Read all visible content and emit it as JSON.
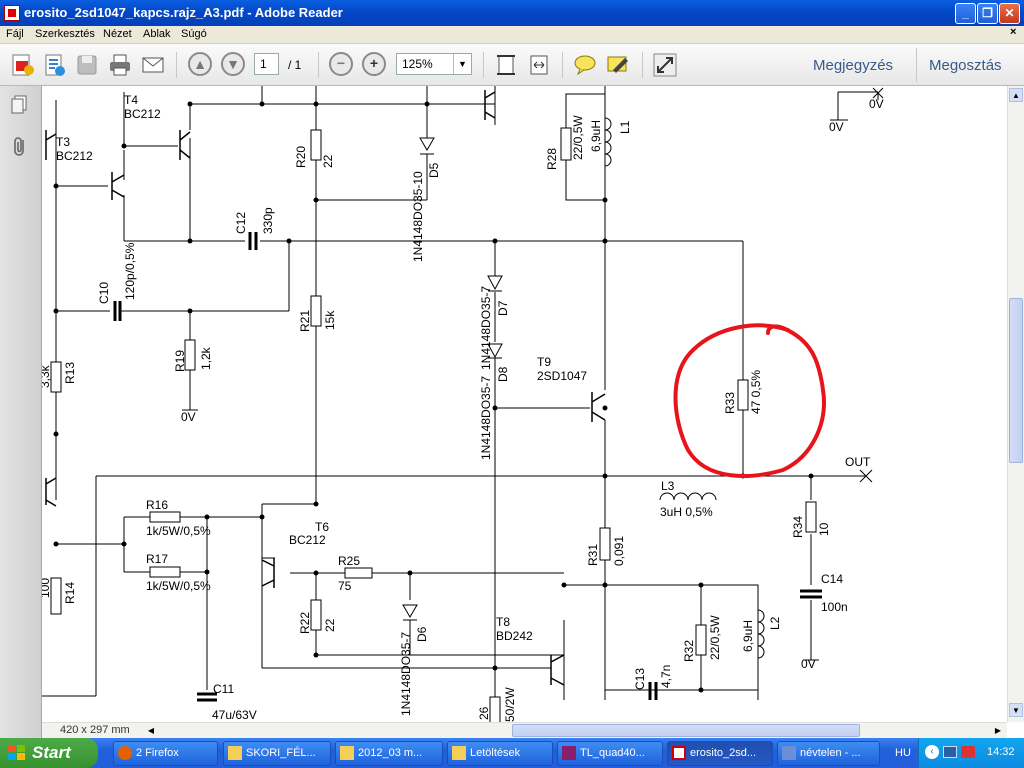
{
  "window": {
    "title": "erosito_2sd1047_kapcs.rajz_A3.pdf - Adobe Reader",
    "buttons": {
      "minimize": "_",
      "maximize": "❐",
      "close": "✕"
    }
  },
  "menu": [
    "Fájl",
    "Szerkesztés",
    "Nézet",
    "Ablak",
    "Súgó"
  ],
  "toolbar": {
    "page_value": "1",
    "page_total": "/ 1",
    "zoom_value": "125%",
    "comment_link": "Megjegyzés",
    "share_link": "Megosztás"
  },
  "statusbar": {
    "page_size": "420 x 297 mm"
  },
  "schematic": {
    "components": {
      "T4": "T4",
      "BC212_a": "BC212",
      "T3": "T3",
      "BC212_b": "BC212",
      "R20": "R20",
      "R20_val": "22",
      "D5": "D5",
      "D5_type": "1N4148DO35-10",
      "R28": "R28",
      "R28_val": "22/0,5W",
      "L1": "L1",
      "L1_val": "6,9uH",
      "C12": "C12",
      "C12_val": "330p",
      "C10": "C10",
      "C10_val": "120p/0,5%",
      "R13": "R13",
      "R13_val": "3,3k",
      "R19": "R19",
      "R19_val": "1,2k",
      "R21": "R21",
      "R21_val": "15k",
      "D7": "D7",
      "D7_type": "1N4148DO35-7",
      "D8": "D8",
      "D8_type": "1N4148DO35-7",
      "T9": "T9",
      "T9_type": "2SD1047",
      "R33": "R33",
      "R33_val": "47 0,5%",
      "OUT": "OUT",
      "L3": "L3",
      "L3_val": "3uH 0,5%",
      "R16": "R16",
      "R16_val": "1k/5W/0,5%",
      "R17": "R17",
      "R17_val": "1k/5W/0,5%",
      "T6": "T6",
      "T6_type": "BC212",
      "R25": "R25",
      "R25_val": "75",
      "R14": "R14",
      "R14_val": "100",
      "R22": "R22",
      "R22_val": "22",
      "D6": "D6",
      "D6_type": "1N4148DO35-7",
      "R31": "R31",
      "R31_val": "0,091",
      "R34": "R34",
      "R34_val": "10",
      "C14": "C14",
      "C14_val": "100n",
      "T8": "T8",
      "T8_type": "BD242",
      "R32": "R32",
      "R32_val": "22/0,5W",
      "L2": "L2",
      "L2_val": "6,9uH",
      "C13": "C13",
      "C13_val": "4,7n",
      "C11": "C11",
      "C11_val": "47u/63V",
      "R26": "26",
      "R26_val": "50/2W",
      "gnd": "0V"
    },
    "annotation_color": "#e8141c"
  },
  "taskbar": {
    "start": "Start",
    "tasks": [
      "2 Firefox",
      "SKORI_FÉL...",
      "2012_03 m...",
      "Letöltések",
      "TL_quad40...",
      "erosito_2sd...",
      "névtelen - ..."
    ],
    "lang": "HU",
    "clock": "14:32"
  }
}
